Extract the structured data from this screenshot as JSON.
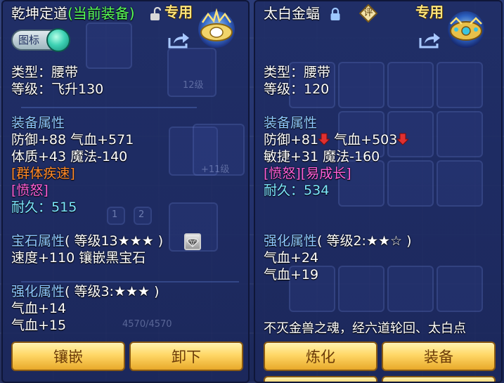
{
  "left": {
    "name": "乾坤定道",
    "status": "(当前装备)",
    "special_tag": "专用",
    "toggle_label": "图标",
    "type_line": "类型：腰带",
    "level_line": "等级：飞升130",
    "equip_attr_header": "装备属性",
    "attr_line1": "防御+88 气血+571",
    "attr_line2": "体质+43 魔法-140",
    "effect1": "[群体疾速]",
    "effect2": "[愤怒]",
    "durability_label": "耐久：",
    "durability_value": "515",
    "gem_header": "宝石属性",
    "gem_level": "( 等级13★★★ )",
    "gem_line": "速度+110 镶嵌黑宝石",
    "enhance_header": "强化属性",
    "enhance_level": "( 等级3:★★★ )",
    "enhance_line1": "气血+14",
    "enhance_line2": "气血+15",
    "btn_inlay": "镶嵌",
    "btn_unequip": "卸下",
    "bg_level_text": "12级",
    "bg_level_text2": "+11级",
    "bg_bar_text": "4570/4570",
    "bg_page1": "1",
    "bg_page2": "2"
  },
  "right": {
    "name": "太白金蝠",
    "seal_char": "评",
    "special_tag": "专用",
    "type_line": "类型：腰带",
    "level_line": "等级：120",
    "equip_attr_header": "装备属性",
    "attr_a1": "防御+81",
    "attr_a2": " 气血+503",
    "attr_line2": "敏捷+31 魔法-160",
    "effect1": "[愤怒][易成长]",
    "durability_label": "耐久：",
    "durability_value": "534",
    "enhance_header": "强化属性",
    "enhance_level": "( 等级2:★★☆ )",
    "enhance_line1": "气血+24",
    "enhance_line2": "气血+19",
    "description": "不灭金兽之魂，经六道轮回、太白点",
    "btn_refine": "炼化",
    "btn_equip": "装备"
  },
  "colors": {
    "title_white": "#ffffff",
    "status_green": "#59ff59",
    "header_blue": "#8ec8ff",
    "effect_orange": "#ff8a2a",
    "effect_pink": "#ff5fd8",
    "durability_cyan": "#7de8ff",
    "button_gold": "#ffd766",
    "down_arrow_red": "#e03030"
  },
  "icons": {
    "left_lock": "unlocked-padlock-icon",
    "right_lock": "locked-padlock-icon",
    "share": "share-arrow-icon",
    "gem": "gem-stone-icon",
    "seal": "appraisal-seal-icon",
    "down_arrow": "red-down-arrow-icon"
  }
}
